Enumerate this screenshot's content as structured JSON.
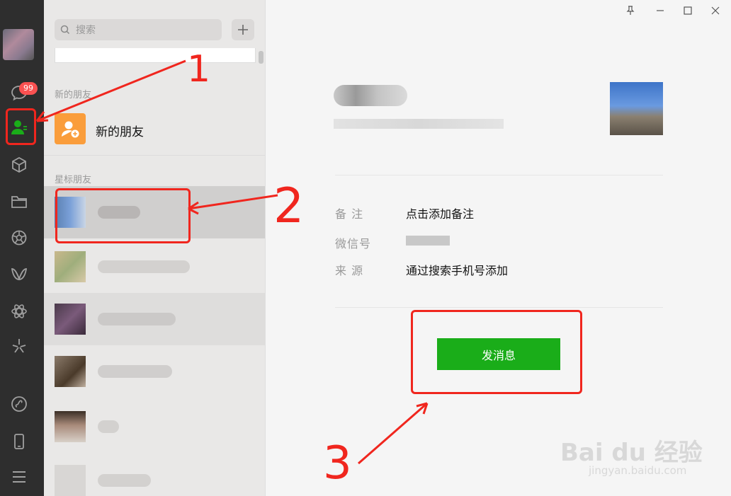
{
  "sidebar": {
    "unread_badge": "99",
    "items": [
      {
        "name": "chat-icon"
      },
      {
        "name": "contacts-icon"
      },
      {
        "name": "favorites-icon"
      },
      {
        "name": "files-icon"
      },
      {
        "name": "moments-icon"
      },
      {
        "name": "channels-icon"
      },
      {
        "name": "search-apps-icon"
      },
      {
        "name": "mini-programs-icon"
      }
    ],
    "bottom_items": [
      {
        "name": "mini-program-icon"
      },
      {
        "name": "phone-icon"
      },
      {
        "name": "menu-icon"
      }
    ]
  },
  "contacts": {
    "search_placeholder": "搜索",
    "add_label": "+",
    "section_new": "新的朋友",
    "new_friend_label": "新的朋友",
    "section_starred": "星标朋友"
  },
  "profile": {
    "remark_label": "备 注",
    "remark_value": "点击添加备注",
    "wechat_id_label": "微信号",
    "source_label": "来 源",
    "source_value": "通过搜索手机号添加",
    "send_button": "发消息"
  },
  "annotations": {
    "step1": "1",
    "step2": "2",
    "step3": "3"
  },
  "watermark": {
    "brand": "Bai du 经验",
    "url": "jingyan.baidu.com"
  },
  "colors": {
    "sidebar_bg": "#2e2e2e",
    "accent_green": "#1aad19",
    "badge_red": "#fa5151",
    "annotation_red": "#f0261e"
  }
}
